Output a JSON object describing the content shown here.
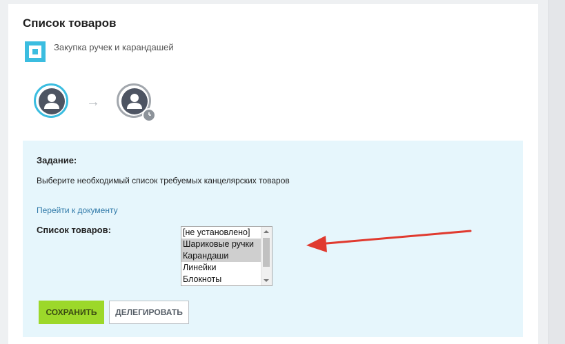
{
  "page": {
    "title": "Список товаров",
    "process_name": "Закупка ручек и карандашей"
  },
  "icons": {
    "process": "process-square-icon",
    "step_arrow": "→",
    "avatar": "user-avatar-icon",
    "clock": "clock-icon"
  },
  "task": {
    "label": "Задание:",
    "description": "Выберите необходимый список требуемых канцелярских товаров",
    "document_link": "Перейти к документу",
    "list_label": "Список товаров:",
    "options": [
      {
        "label": "[не установлено]",
        "selected": false
      },
      {
        "label": "Шариковые ручки",
        "selected": true
      },
      {
        "label": "Карандаши",
        "selected": true
      },
      {
        "label": "Линейки",
        "selected": false
      },
      {
        "label": "Блокноты",
        "selected": false
      }
    ]
  },
  "actions": {
    "save": "СОХРАНИТЬ",
    "delegate": "ДЕЛЕГИРОВАТЬ"
  },
  "colors": {
    "accent": "#3bbde0",
    "save_button": "#9cd82a",
    "task_background": "#e6f6fc",
    "annotation_arrow": "#e03a2f"
  }
}
